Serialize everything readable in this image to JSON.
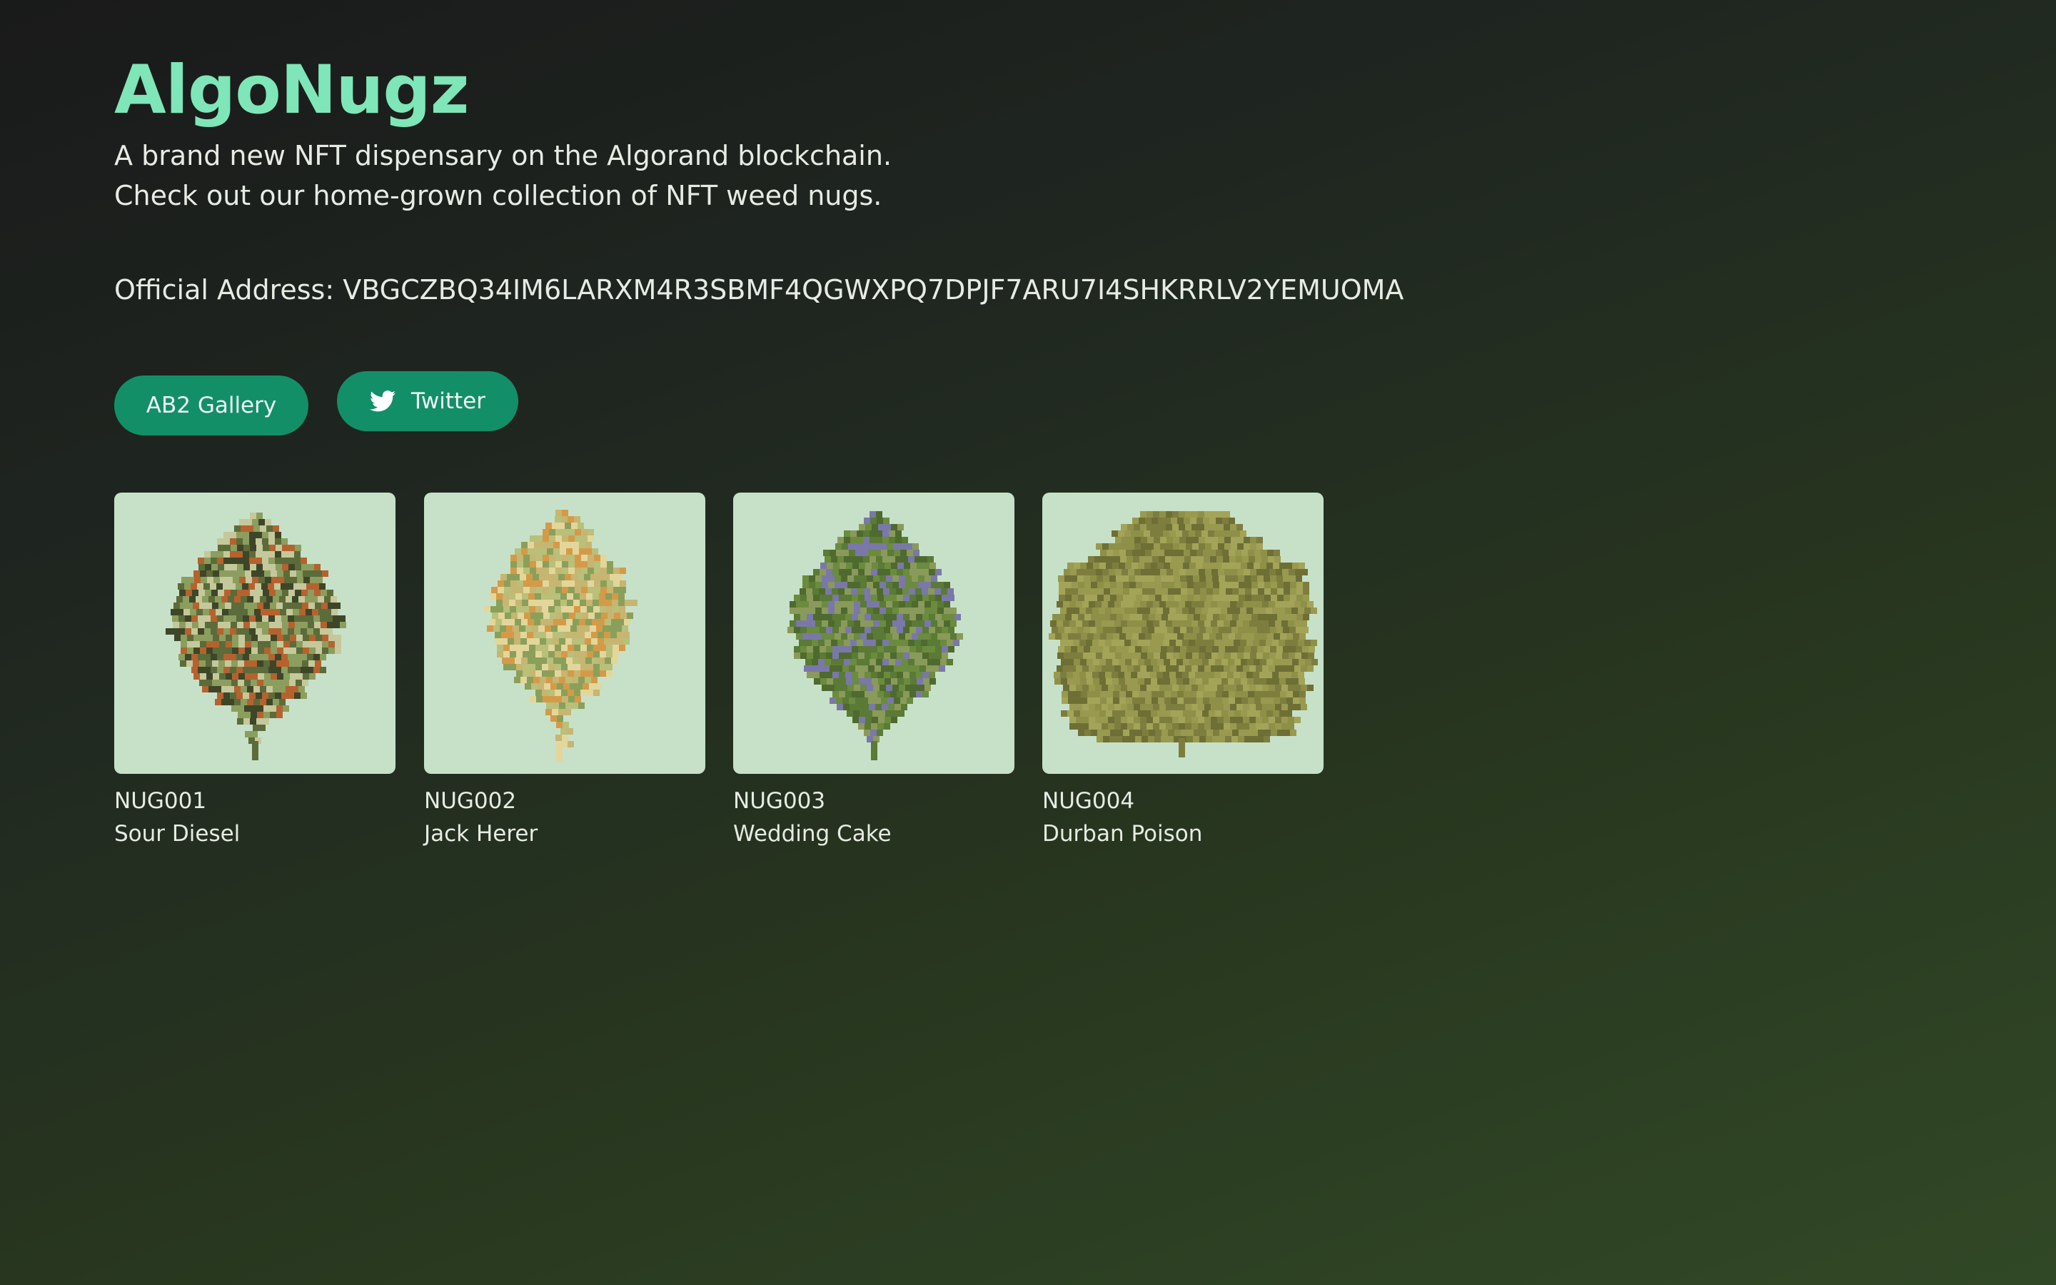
{
  "header": {
    "title": "AlgoNugz",
    "tagline_line1": "A brand new NFT dispensary on the Algorand blockchain.",
    "tagline_line2": "Check out our home-grown collection of NFT weed nugs.",
    "address": "Official Address: VBGCZBQ34IM6LARXM4R3SBMF4QGWXPQ7DPJF7ARU7I4SHKRRLV2YEMUOMA"
  },
  "links": {
    "gallery_label": "AB2 Gallery",
    "twitter_label": "Twitter",
    "twitter_icon": "twitter-bird-icon"
  },
  "colors": {
    "accent": "#7ee6b8",
    "button": "#138f67",
    "card_bg": "#c7e1c9"
  },
  "nugs": [
    {
      "id": "NUG001",
      "name": "Sour Diesel",
      "palette": [
        "#8b9e5e",
        "#5c6b3a",
        "#c5c89a",
        "#b5622f",
        "#3e4628"
      ]
    },
    {
      "id": "NUG002",
      "name": "Jack Herer",
      "palette": [
        "#b8c07a",
        "#e3d69a",
        "#d59a48",
        "#8aa05a",
        "#c7b572"
      ]
    },
    {
      "id": "NUG003",
      "name": "Wedding Cake",
      "palette": [
        "#6b8b3e",
        "#5a7a36",
        "#7a78a8",
        "#8a9a5a",
        "#4f6a2e"
      ]
    },
    {
      "id": "NUG004",
      "name": "Durban Poison",
      "palette": [
        "#8f9048",
        "#7d7e3e",
        "#a3a458",
        "#6e6f35",
        "#999a50"
      ]
    }
  ]
}
